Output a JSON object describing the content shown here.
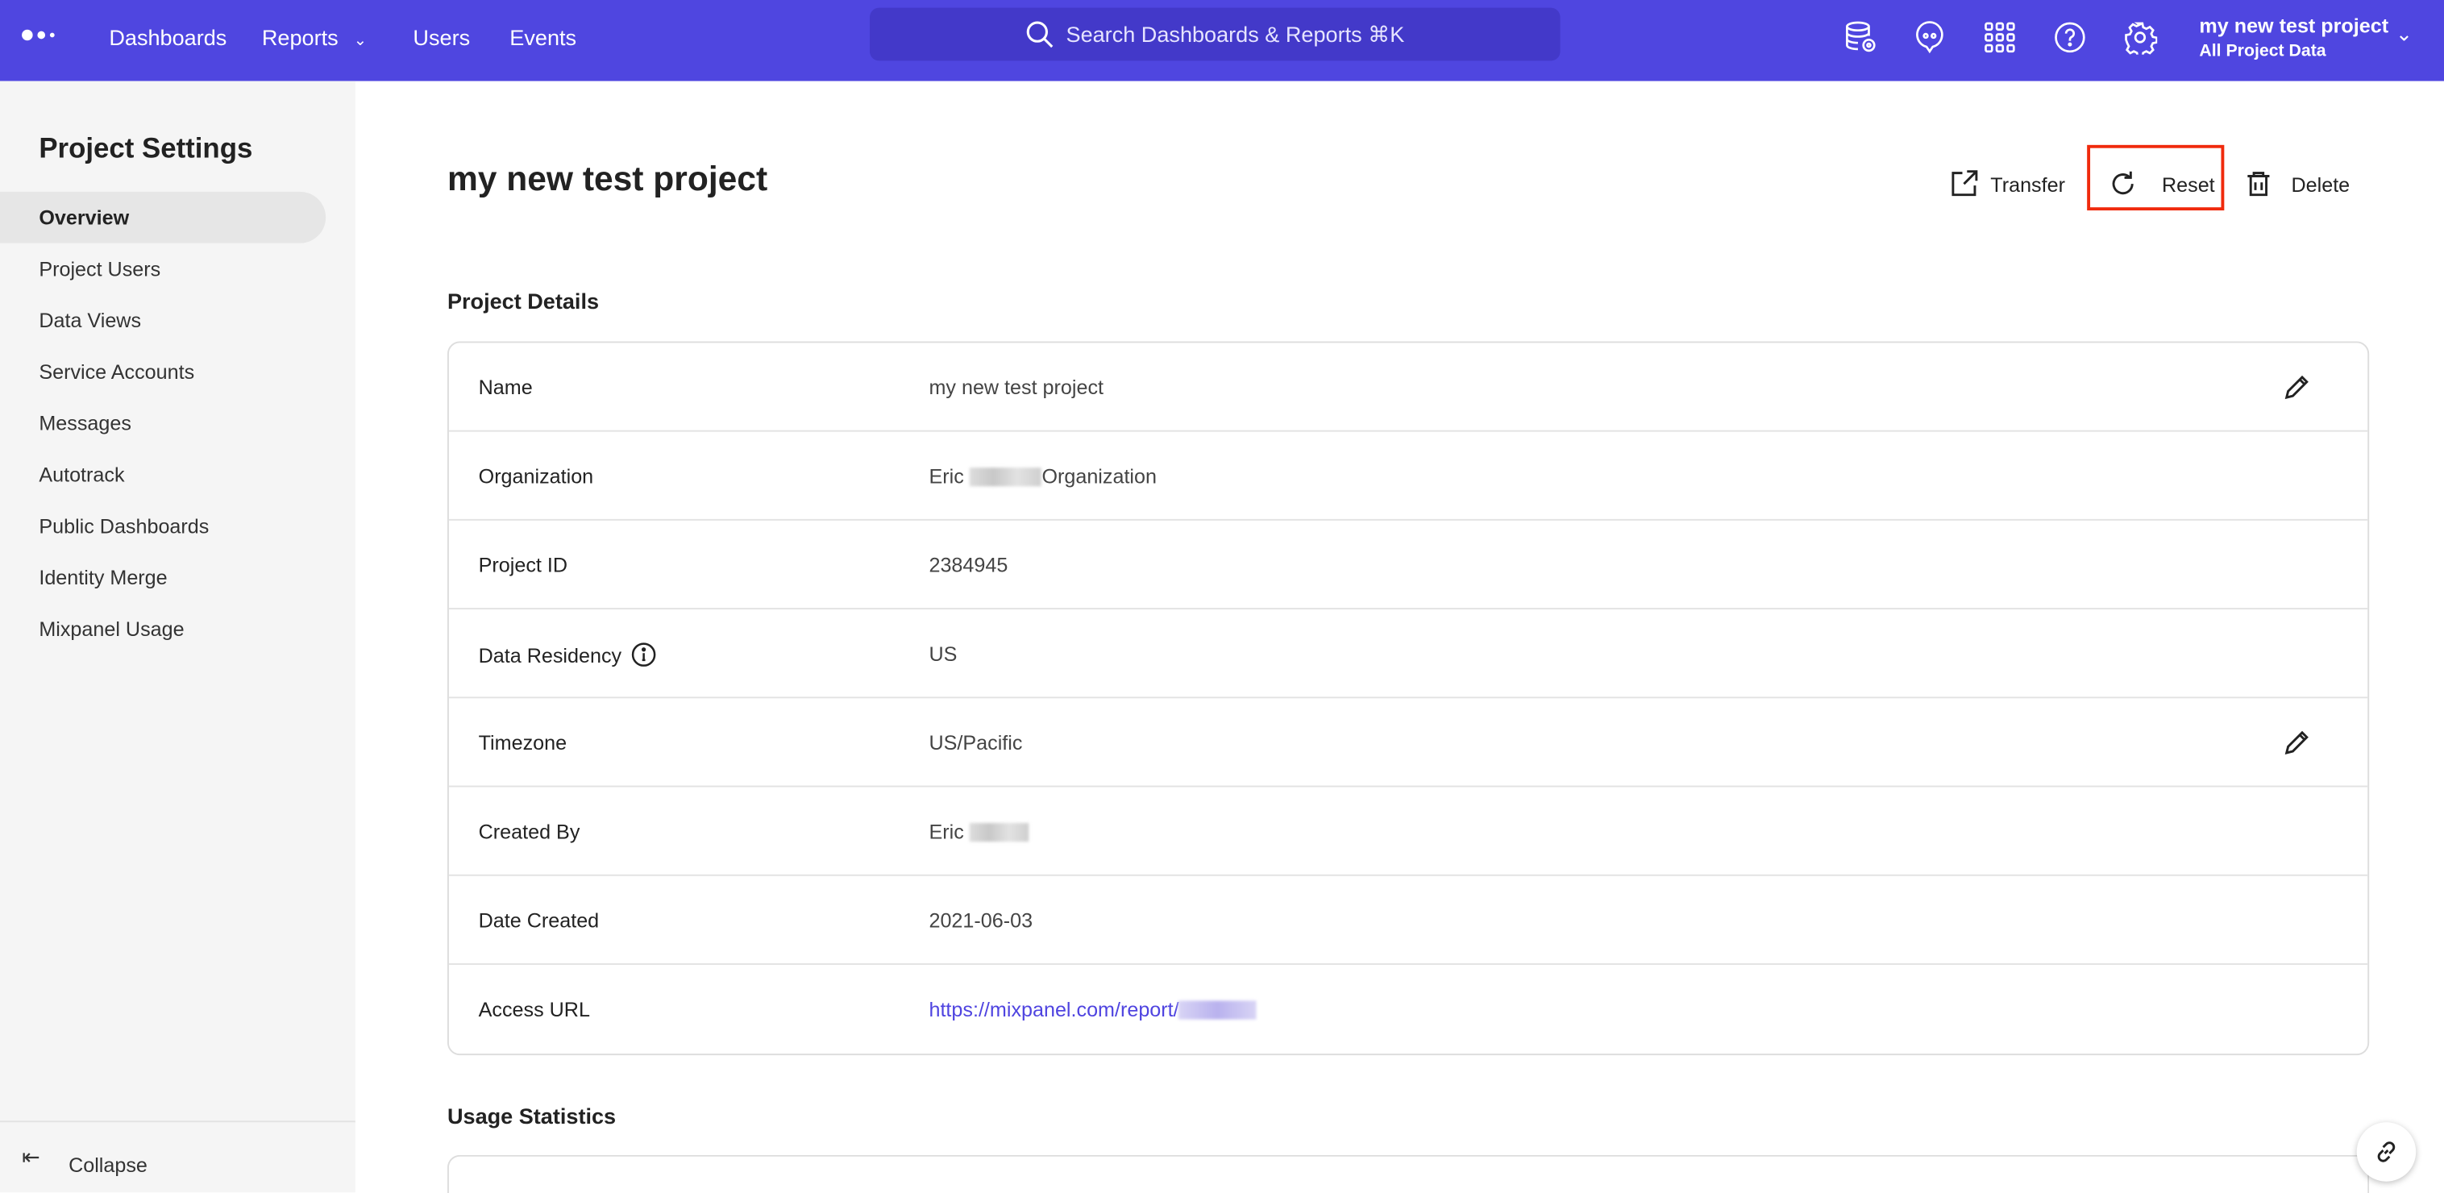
{
  "topbar": {
    "nav": [
      "Dashboards",
      "Reports",
      "Users",
      "Events"
    ],
    "search_placeholder": "Search Dashboards & Reports ⌘K",
    "project_name": "my new test project",
    "project_scope": "All Project Data",
    "icons": [
      "database-gear-icon",
      "chat-icon",
      "apps-grid-icon",
      "help-icon",
      "settings-gear-icon"
    ],
    "color": "#4f46e0"
  },
  "sidebar": {
    "title": "Project Settings",
    "items": [
      "Overview",
      "Project Users",
      "Data Views",
      "Service Accounts",
      "Messages",
      "Autotrack",
      "Public Dashboards",
      "Identity Merge",
      "Mixpanel Usage"
    ],
    "active": "Overview",
    "collapse": "Collapse"
  },
  "main": {
    "title": "my new test project",
    "actions": {
      "transfer": "Transfer",
      "reset": "Reset",
      "delete": "Delete"
    },
    "details_heading": "Project Details",
    "details": [
      {
        "label": "Name",
        "value": "my new test project",
        "editable": true
      },
      {
        "label": "Organization",
        "value_pre": "Eric",
        "value_post": "Organization"
      },
      {
        "label": "Project ID",
        "value": "2384945"
      },
      {
        "label": "Data Residency",
        "value": "US",
        "info": true
      },
      {
        "label": "Timezone",
        "value": "US/Pacific",
        "editable": true
      },
      {
        "label": "Created By",
        "value_pre": "Eric"
      },
      {
        "label": "Date Created",
        "value": "2021-06-03"
      },
      {
        "label": "Access URL",
        "value_pre": "https://mixpanel.com/report/"
      }
    ],
    "usage_heading": "Usage Statistics"
  },
  "highlight_color": "#f02a0c"
}
